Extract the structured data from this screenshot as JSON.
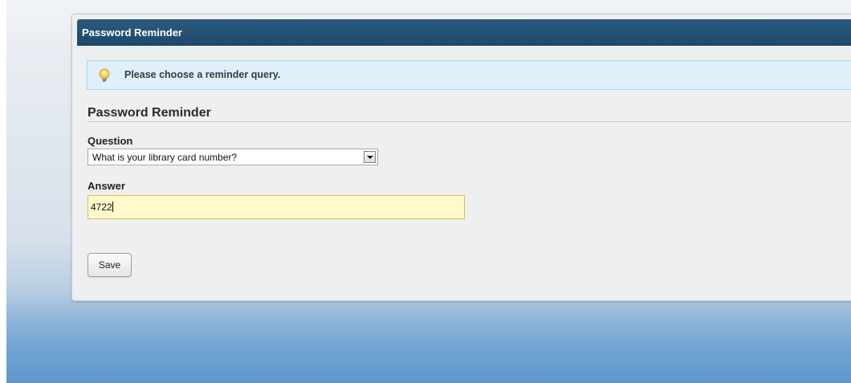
{
  "panel": {
    "title": "Password Reminder"
  },
  "info": {
    "icon": "lightbulb-icon",
    "message": "Please choose a reminder query."
  },
  "form": {
    "section_title": "Password Reminder",
    "question_label": "Question",
    "question_value": "What is your library card number?",
    "answer_label": "Answer",
    "answer_value": "4722",
    "save_label": "Save"
  },
  "colors": {
    "header_bg": "#1e486b",
    "info_bg": "#dff0fb",
    "answer_bg": "#fff9cc",
    "answer_border": "#e1c04b"
  }
}
